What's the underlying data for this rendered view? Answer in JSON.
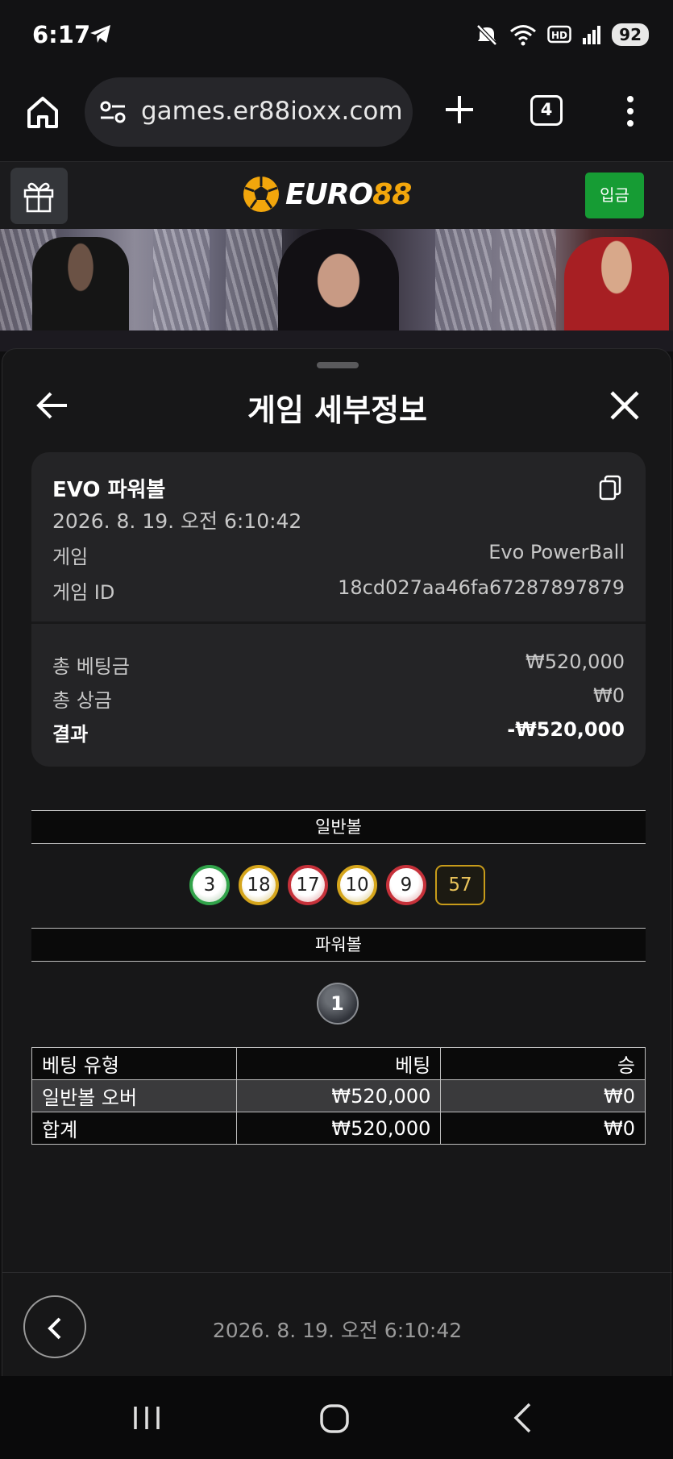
{
  "status_bar": {
    "time": "6:17",
    "battery": "92",
    "icons": [
      "telegram-icon",
      "mute-icon",
      "wifi-icon",
      "hd-icon",
      "signal-icon",
      "battery-icon"
    ]
  },
  "browser": {
    "url": "games.er88ioxx.com",
    "tab_count": "4",
    "icons": [
      "home-icon",
      "site-settings-icon",
      "new-tab-icon",
      "menu-icon"
    ]
  },
  "site_header": {
    "logo_text_1": "EURO",
    "logo_text_2": "88",
    "deposit_label": "입금",
    "accent": "#f2a60c",
    "deposit_color": "#169c34"
  },
  "sheet": {
    "title": "게임 세부정보",
    "card": {
      "game_title": "EVO 파워볼",
      "datetime": "2026. 8. 19. 오전 6:10:42",
      "rows": [
        {
          "label": "게임",
          "value": "Evo PowerBall"
        },
        {
          "label": "게임 ID",
          "value": "18cd027aa46fa67287897879"
        }
      ],
      "totals": [
        {
          "label": "총 베팅금",
          "value": "₩520,000"
        },
        {
          "label": "총 상금",
          "value": "₩0"
        },
        {
          "label": "결과",
          "value": "-₩520,000"
        }
      ]
    },
    "normal_ball_header": "일반볼",
    "normal_balls": [
      {
        "number": "3",
        "color": "green"
      },
      {
        "number": "18",
        "color": "yellow"
      },
      {
        "number": "17",
        "color": "red"
      },
      {
        "number": "10",
        "color": "yellow"
      },
      {
        "number": "9",
        "color": "red"
      }
    ],
    "normal_sum": "57",
    "power_ball_header": "파워볼",
    "power_ball": "1",
    "bet_table": {
      "headers": [
        "베팅 유형",
        "베팅",
        "승"
      ],
      "rows": [
        [
          "일반볼 오버",
          "₩520,000",
          "₩0"
        ],
        [
          "합계",
          "₩520,000",
          "₩0"
        ]
      ]
    },
    "footer_date": "2026. 8. 19. 오전 6:10:42"
  }
}
